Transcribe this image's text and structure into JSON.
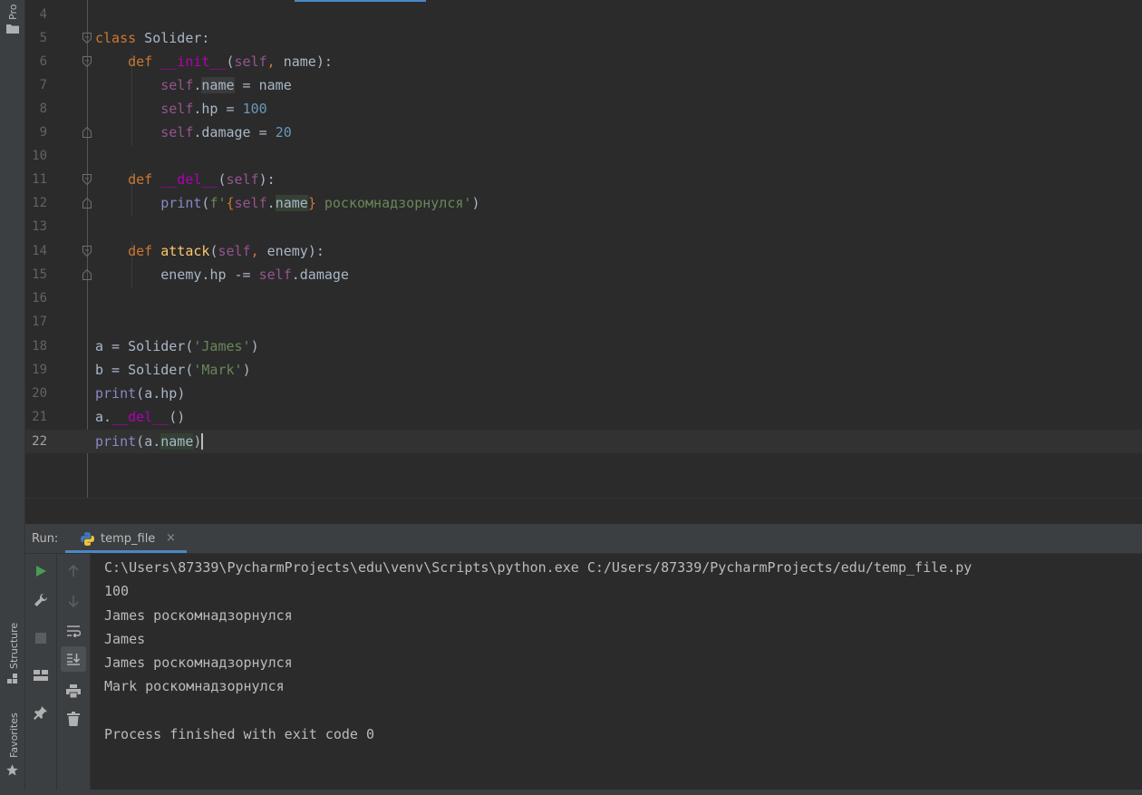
{
  "left_strip": {
    "project_label": "Pro",
    "structure_label": "Structure",
    "favorites_label": "Favorites"
  },
  "editor": {
    "lines": [
      {
        "num": "4"
      },
      {
        "num": "5"
      },
      {
        "num": "6"
      },
      {
        "num": "7"
      },
      {
        "num": "8"
      },
      {
        "num": "9"
      },
      {
        "num": "10"
      },
      {
        "num": "11"
      },
      {
        "num": "12"
      },
      {
        "num": "13"
      },
      {
        "num": "14"
      },
      {
        "num": "15"
      },
      {
        "num": "16"
      },
      {
        "num": "17"
      },
      {
        "num": "18"
      },
      {
        "num": "19"
      },
      {
        "num": "20"
      },
      {
        "num": "21"
      },
      {
        "num": "22"
      }
    ],
    "tokens": {
      "class_kw": "class",
      "class_name": " Solider:",
      "def": "def",
      "init": "__init__",
      "del": "__del__",
      "attack": "attack",
      "self": "self",
      "name": "name",
      "hp": "hp",
      "damage": "damage",
      "enemy": "enemy",
      "print": "print",
      "num100": "100",
      "num20": "20",
      "str_fpref": "f'",
      "str_suffix": " роскомнадзорнулся'",
      "str_james": "'James'",
      "str_mark": "'Mark'",
      "solider": "Solider",
      "a": "a",
      "b": "b"
    }
  },
  "run": {
    "label": "Run:",
    "tab_label": "temp_file",
    "close": "×",
    "console": [
      "C:\\Users\\87339\\PycharmProjects\\edu\\venv\\Scripts\\python.exe C:/Users/87339/PycharmProjects/edu/temp_file.py",
      "100",
      "James роскомнадзорнулся",
      "James",
      "James роскомнадзорнулся",
      "Mark роскомнадзорнулся",
      "",
      "Process finished with exit code 0"
    ]
  },
  "colors": {
    "keyword": "#cc7832",
    "self": "#94558d",
    "magic": "#b200b2",
    "number": "#6897bb",
    "string": "#6a8759",
    "function": "#ffc66d",
    "builtin": "#8888c6",
    "run_icon": "#499c54",
    "accent": "#4a88c7"
  },
  "icons": {
    "project": "folder-icon",
    "structure": "structure-icon",
    "favorites": "star-icon",
    "run": "play-icon",
    "settings": "wrench-icon",
    "stop": "stop-icon",
    "layout": "layout-icon",
    "pin": "pin-icon",
    "up": "arrow-up-icon",
    "down": "arrow-down-icon",
    "wrap": "soft-wrap-icon",
    "scroll": "scroll-to-end-icon",
    "print": "print-icon",
    "trash": "trash-icon",
    "python": "python-icon"
  }
}
